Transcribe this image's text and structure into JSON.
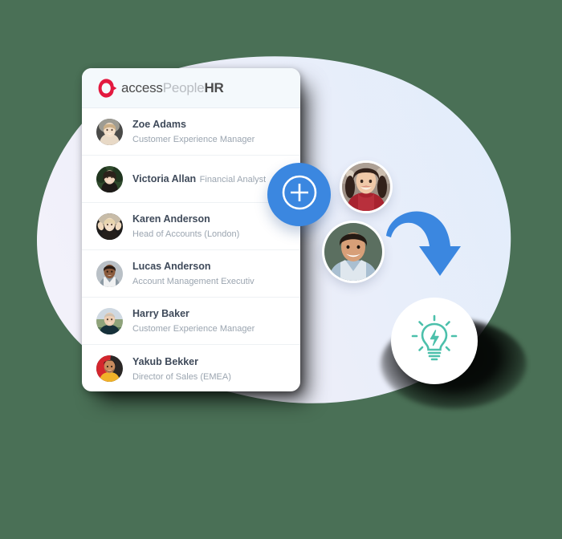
{
  "brand": {
    "logo_icon": "access-ring-logo-icon",
    "word_access": "access",
    "word_people": "People",
    "word_hr": "HR",
    "logo_color": "#e3193f",
    "accent_blue": "#3b87e0",
    "accent_teal": "#4cc0ab"
  },
  "card": {
    "employees": [
      {
        "name": "Zoe Adams",
        "role": "Customer Experience Manager",
        "avatar": "avatar-zoe-adams"
      },
      {
        "name": "Victoria Allan",
        "role": "Financial Analyst",
        "avatar": "avatar-victoria-allan"
      },
      {
        "name": "Karen Anderson",
        "role": "Head of Accounts (London)",
        "avatar": "avatar-karen-anderson"
      },
      {
        "name": "Lucas Anderson",
        "role": "Account Management Executiv",
        "avatar": "avatar-lucas-anderson"
      },
      {
        "name": "Harry Baker",
        "role": "Customer Experience Manager",
        "avatar": "avatar-harry-baker"
      },
      {
        "name": "Yakub Bekker",
        "role": "Director of Sales (EMEA)",
        "avatar": "avatar-yakub-bekker"
      }
    ]
  },
  "overlay": {
    "add_button_icon": "plus-circle-icon",
    "arrow_icon": "curved-arrow-down-right-icon",
    "idea_icon": "lightbulb-bolt-icon",
    "floating_avatars": [
      {
        "name": "floating-avatar-woman-red-top"
      },
      {
        "name": "floating-avatar-man-blue-shirt"
      }
    ]
  },
  "background": {
    "blob_color_left": "#f1f1fa",
    "blob_color_right": "#e3eefb"
  }
}
